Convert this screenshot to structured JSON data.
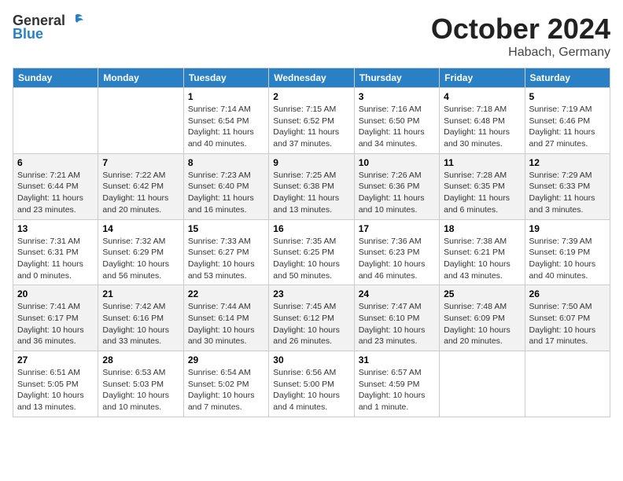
{
  "logo": {
    "general": "General",
    "blue": "Blue"
  },
  "header": {
    "month": "October 2024",
    "location": "Habach, Germany"
  },
  "weekdays": [
    "Sunday",
    "Monday",
    "Tuesday",
    "Wednesday",
    "Thursday",
    "Friday",
    "Saturday"
  ],
  "weeks": [
    [
      null,
      null,
      {
        "day": "1",
        "sunrise": "Sunrise: 7:14 AM",
        "sunset": "Sunset: 6:54 PM",
        "daylight": "Daylight: 11 hours and 40 minutes."
      },
      {
        "day": "2",
        "sunrise": "Sunrise: 7:15 AM",
        "sunset": "Sunset: 6:52 PM",
        "daylight": "Daylight: 11 hours and 37 minutes."
      },
      {
        "day": "3",
        "sunrise": "Sunrise: 7:16 AM",
        "sunset": "Sunset: 6:50 PM",
        "daylight": "Daylight: 11 hours and 34 minutes."
      },
      {
        "day": "4",
        "sunrise": "Sunrise: 7:18 AM",
        "sunset": "Sunset: 6:48 PM",
        "daylight": "Daylight: 11 hours and 30 minutes."
      },
      {
        "day": "5",
        "sunrise": "Sunrise: 7:19 AM",
        "sunset": "Sunset: 6:46 PM",
        "daylight": "Daylight: 11 hours and 27 minutes."
      }
    ],
    [
      {
        "day": "6",
        "sunrise": "Sunrise: 7:21 AM",
        "sunset": "Sunset: 6:44 PM",
        "daylight": "Daylight: 11 hours and 23 minutes."
      },
      {
        "day": "7",
        "sunrise": "Sunrise: 7:22 AM",
        "sunset": "Sunset: 6:42 PM",
        "daylight": "Daylight: 11 hours and 20 minutes."
      },
      {
        "day": "8",
        "sunrise": "Sunrise: 7:23 AM",
        "sunset": "Sunset: 6:40 PM",
        "daylight": "Daylight: 11 hours and 16 minutes."
      },
      {
        "day": "9",
        "sunrise": "Sunrise: 7:25 AM",
        "sunset": "Sunset: 6:38 PM",
        "daylight": "Daylight: 11 hours and 13 minutes."
      },
      {
        "day": "10",
        "sunrise": "Sunrise: 7:26 AM",
        "sunset": "Sunset: 6:36 PM",
        "daylight": "Daylight: 11 hours and 10 minutes."
      },
      {
        "day": "11",
        "sunrise": "Sunrise: 7:28 AM",
        "sunset": "Sunset: 6:35 PM",
        "daylight": "Daylight: 11 hours and 6 minutes."
      },
      {
        "day": "12",
        "sunrise": "Sunrise: 7:29 AM",
        "sunset": "Sunset: 6:33 PM",
        "daylight": "Daylight: 11 hours and 3 minutes."
      }
    ],
    [
      {
        "day": "13",
        "sunrise": "Sunrise: 7:31 AM",
        "sunset": "Sunset: 6:31 PM",
        "daylight": "Daylight: 11 hours and 0 minutes."
      },
      {
        "day": "14",
        "sunrise": "Sunrise: 7:32 AM",
        "sunset": "Sunset: 6:29 PM",
        "daylight": "Daylight: 10 hours and 56 minutes."
      },
      {
        "day": "15",
        "sunrise": "Sunrise: 7:33 AM",
        "sunset": "Sunset: 6:27 PM",
        "daylight": "Daylight: 10 hours and 53 minutes."
      },
      {
        "day": "16",
        "sunrise": "Sunrise: 7:35 AM",
        "sunset": "Sunset: 6:25 PM",
        "daylight": "Daylight: 10 hours and 50 minutes."
      },
      {
        "day": "17",
        "sunrise": "Sunrise: 7:36 AM",
        "sunset": "Sunset: 6:23 PM",
        "daylight": "Daylight: 10 hours and 46 minutes."
      },
      {
        "day": "18",
        "sunrise": "Sunrise: 7:38 AM",
        "sunset": "Sunset: 6:21 PM",
        "daylight": "Daylight: 10 hours and 43 minutes."
      },
      {
        "day": "19",
        "sunrise": "Sunrise: 7:39 AM",
        "sunset": "Sunset: 6:19 PM",
        "daylight": "Daylight: 10 hours and 40 minutes."
      }
    ],
    [
      {
        "day": "20",
        "sunrise": "Sunrise: 7:41 AM",
        "sunset": "Sunset: 6:17 PM",
        "daylight": "Daylight: 10 hours and 36 minutes."
      },
      {
        "day": "21",
        "sunrise": "Sunrise: 7:42 AM",
        "sunset": "Sunset: 6:16 PM",
        "daylight": "Daylight: 10 hours and 33 minutes."
      },
      {
        "day": "22",
        "sunrise": "Sunrise: 7:44 AM",
        "sunset": "Sunset: 6:14 PM",
        "daylight": "Daylight: 10 hours and 30 minutes."
      },
      {
        "day": "23",
        "sunrise": "Sunrise: 7:45 AM",
        "sunset": "Sunset: 6:12 PM",
        "daylight": "Daylight: 10 hours and 26 minutes."
      },
      {
        "day": "24",
        "sunrise": "Sunrise: 7:47 AM",
        "sunset": "Sunset: 6:10 PM",
        "daylight": "Daylight: 10 hours and 23 minutes."
      },
      {
        "day": "25",
        "sunrise": "Sunrise: 7:48 AM",
        "sunset": "Sunset: 6:09 PM",
        "daylight": "Daylight: 10 hours and 20 minutes."
      },
      {
        "day": "26",
        "sunrise": "Sunrise: 7:50 AM",
        "sunset": "Sunset: 6:07 PM",
        "daylight": "Daylight: 10 hours and 17 minutes."
      }
    ],
    [
      {
        "day": "27",
        "sunrise": "Sunrise: 6:51 AM",
        "sunset": "Sunset: 5:05 PM",
        "daylight": "Daylight: 10 hours and 13 minutes."
      },
      {
        "day": "28",
        "sunrise": "Sunrise: 6:53 AM",
        "sunset": "Sunset: 5:03 PM",
        "daylight": "Daylight: 10 hours and 10 minutes."
      },
      {
        "day": "29",
        "sunrise": "Sunrise: 6:54 AM",
        "sunset": "Sunset: 5:02 PM",
        "daylight": "Daylight: 10 hours and 7 minutes."
      },
      {
        "day": "30",
        "sunrise": "Sunrise: 6:56 AM",
        "sunset": "Sunset: 5:00 PM",
        "daylight": "Daylight: 10 hours and 4 minutes."
      },
      {
        "day": "31",
        "sunrise": "Sunrise: 6:57 AM",
        "sunset": "Sunset: 4:59 PM",
        "daylight": "Daylight: 10 hours and 1 minute."
      },
      null,
      null
    ]
  ]
}
